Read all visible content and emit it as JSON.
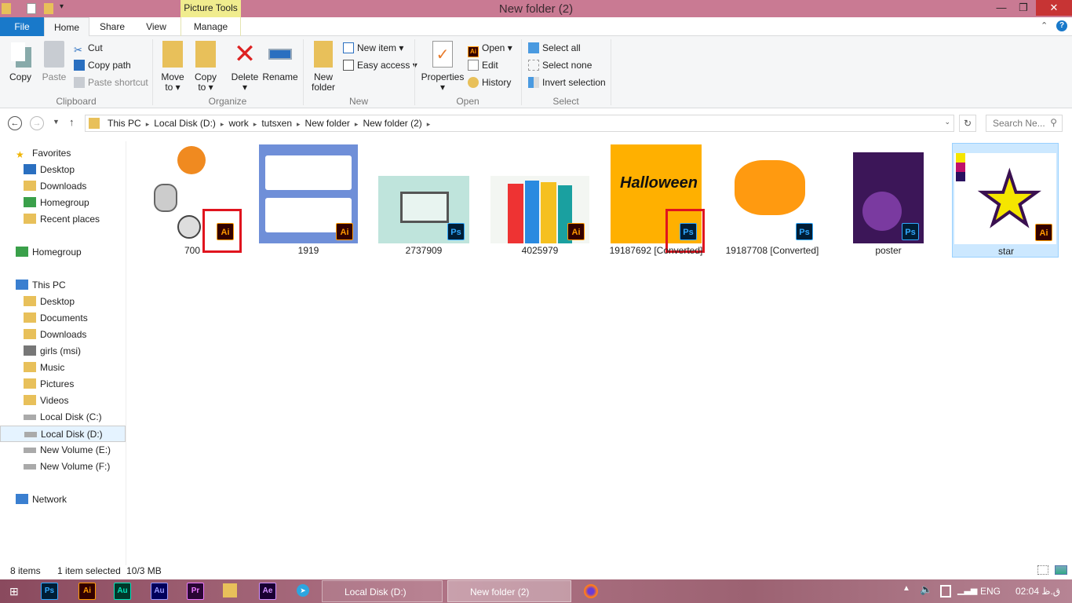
{
  "window": {
    "title": "New folder (2)",
    "context_tab": "Picture Tools",
    "minimize": "—",
    "maximize": "❐",
    "close": "✕"
  },
  "tabs": [
    {
      "label": "File"
    },
    {
      "label": "Home"
    },
    {
      "label": "Share"
    },
    {
      "label": "View"
    },
    {
      "label": "Manage"
    }
  ],
  "ribbon": {
    "clipboard": {
      "label": "Clipboard",
      "copy": "Copy",
      "paste": "Paste",
      "cut": "Cut",
      "copy_path": "Copy path",
      "paste_shortcut": "Paste shortcut"
    },
    "organize": {
      "label": "Organize",
      "move_to": "Move to ▾",
      "copy_to": "Copy to ▾",
      "delete": "Delete ▾",
      "rename": "Rename"
    },
    "new": {
      "label": "New",
      "new_folder": "New folder",
      "new_item": "New item ▾",
      "easy_access": "Easy access ▾"
    },
    "open": {
      "label": "Open",
      "properties": "Properties ▾",
      "open": "Open ▾",
      "edit": "Edit",
      "history": "History"
    },
    "select": {
      "label": "Select",
      "select_all": "Select all",
      "select_none": "Select none",
      "invert": "Invert selection"
    }
  },
  "address": {
    "crumbs": [
      "This PC",
      "Local Disk (D:)",
      "work",
      "tutsxen",
      "New folder",
      "New folder (2)"
    ],
    "search_placeholder": "Search Ne..."
  },
  "sidebar": [
    {
      "label": "Favorites",
      "icon": "star-icon",
      "head": true
    },
    {
      "label": "Desktop",
      "icon": "desktop-icon"
    },
    {
      "label": "Downloads",
      "icon": "folder-icon"
    },
    {
      "label": "Homegroup",
      "icon": "homegroup-icon"
    },
    {
      "label": "Recent places",
      "icon": "folder-icon"
    },
    {
      "label": "Homegroup",
      "icon": "homegroup-icon",
      "head": true
    },
    {
      "label": "This PC",
      "icon": "computer-icon",
      "head": true
    },
    {
      "label": "Desktop",
      "icon": "folder-icon"
    },
    {
      "label": "Documents",
      "icon": "folder-icon"
    },
    {
      "label": "Downloads",
      "icon": "folder-icon"
    },
    {
      "label": "girls (msi)",
      "icon": "network-drive-icon"
    },
    {
      "label": "Music",
      "icon": "folder-icon"
    },
    {
      "label": "Pictures",
      "icon": "folder-icon"
    },
    {
      "label": "Videos",
      "icon": "folder-icon"
    },
    {
      "label": "Local Disk (C:)",
      "icon": "drive-icon"
    },
    {
      "label": "Local Disk (D:)",
      "icon": "drive-icon",
      "selected": true
    },
    {
      "label": "New Volume (E:)",
      "icon": "drive-icon"
    },
    {
      "label": "New Volume (F:)",
      "icon": "drive-icon"
    },
    {
      "label": "Network",
      "icon": "network-icon",
      "head": true
    }
  ],
  "files": [
    {
      "name": "700",
      "type": "Ai",
      "thumb": "#ffffff",
      "highlighted": true
    },
    {
      "name": "1919",
      "type": "Ai",
      "thumb": "#6f8fd8"
    },
    {
      "name": "2737909",
      "type": "Ps",
      "thumb": "#bfe4dc"
    },
    {
      "name": "4025979",
      "type": "Ai",
      "thumb": "#f3f6f2"
    },
    {
      "name": "19187692 [Converted]",
      "type": "Ps",
      "thumb": "#ffb000",
      "highlighted": true
    },
    {
      "name": "19187708 [Converted]",
      "type": "Ps",
      "thumb": "#ffffff"
    },
    {
      "name": "poster",
      "type": "Ps",
      "thumb": "#3c1658"
    },
    {
      "name": "star",
      "type": "Ai",
      "thumb": "#ffffff",
      "selected": true
    }
  ],
  "status": {
    "count": "8 items",
    "selection": "1 item selected",
    "size": "10/3 MB"
  },
  "taskbar": {
    "apps": [
      {
        "label": "Ps",
        "color": "#31a8ff",
        "bg": "#001e36"
      },
      {
        "label": "Ai",
        "color": "#ff9a00",
        "bg": "#330000"
      },
      {
        "label": "Au",
        "color": "#00e4bb",
        "bg": "#00382b"
      },
      {
        "label": "Au",
        "color": "#9999ff",
        "bg": "#00005b"
      },
      {
        "label": "Pr",
        "color": "#ea77ff",
        "bg": "#2a0634"
      },
      {
        "label": "Ae",
        "color": "#d291ff",
        "bg": "#1a0033"
      }
    ],
    "windows": [
      "Local Disk (D:)",
      "New folder (2)"
    ],
    "lang": "ENG",
    "time": "02:04 ق.ظ"
  }
}
